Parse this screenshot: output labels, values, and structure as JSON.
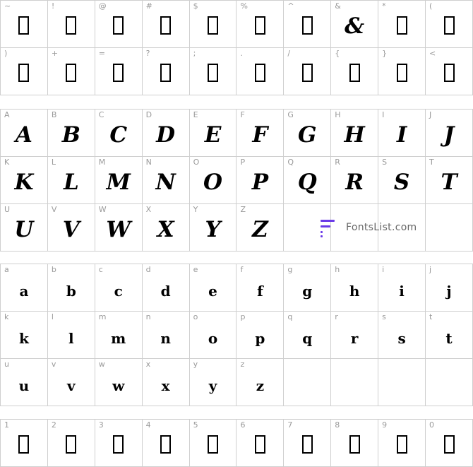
{
  "symbols": [
    {
      "label": "~",
      "glyph": "box"
    },
    {
      "label": "!",
      "glyph": "box"
    },
    {
      "label": "@",
      "glyph": "box"
    },
    {
      "label": "#",
      "glyph": "box"
    },
    {
      "label": "$",
      "glyph": "box"
    },
    {
      "label": "%",
      "glyph": "box"
    },
    {
      "label": "^",
      "glyph": "box"
    },
    {
      "label": "&",
      "glyph": "&"
    },
    {
      "label": "*",
      "glyph": "box"
    },
    {
      "label": "(",
      "glyph": "box"
    },
    {
      "label": ")",
      "glyph": "box"
    },
    {
      "label": "+",
      "glyph": "box"
    },
    {
      "label": "=",
      "glyph": "box"
    },
    {
      "label": "?",
      "glyph": "box"
    },
    {
      "label": ";",
      "glyph": "box"
    },
    {
      "label": ".",
      "glyph": "box"
    },
    {
      "label": "/",
      "glyph": "box"
    },
    {
      "label": "{",
      "glyph": "box"
    },
    {
      "label": "}",
      "glyph": "box"
    },
    {
      "label": "<",
      "glyph": "box"
    }
  ],
  "uppercase": [
    "A",
    "B",
    "C",
    "D",
    "E",
    "F",
    "G",
    "H",
    "I",
    "J",
    "K",
    "L",
    "M",
    "N",
    "O",
    "P",
    "Q",
    "R",
    "S",
    "T",
    "U",
    "V",
    "W",
    "X",
    "Y",
    "Z"
  ],
  "lowercase": [
    "a",
    "b",
    "c",
    "d",
    "e",
    "f",
    "g",
    "h",
    "i",
    "j",
    "k",
    "l",
    "m",
    "n",
    "o",
    "p",
    "q",
    "r",
    "s",
    "t",
    "u",
    "v",
    "w",
    "x",
    "y",
    "z"
  ],
  "digits": [
    "1",
    "2",
    "3",
    "4",
    "5",
    "6",
    "7",
    "8",
    "9",
    "0"
  ],
  "watermark": {
    "text": "FontsList.com",
    "color": "#6a3ae8"
  }
}
